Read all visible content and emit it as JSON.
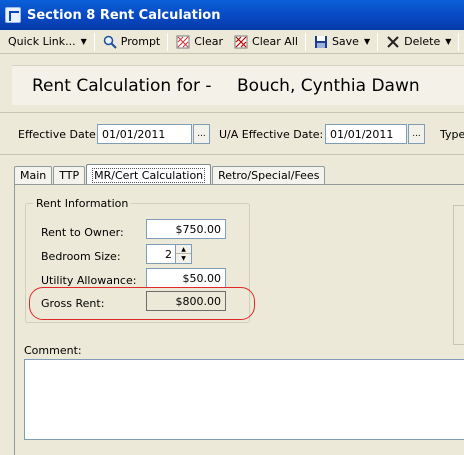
{
  "window": {
    "title": "Section 8 Rent Calculation"
  },
  "toolbar": {
    "quick_link": "Quick Link...",
    "prompt": "Prompt",
    "clear": "Clear",
    "clear_all": "Clear All",
    "save": "Save",
    "delete": "Delete"
  },
  "header": {
    "label": "Rent Calculation for -",
    "name": "Bouch, Cynthia Dawn"
  },
  "dates": {
    "effective_label": "Effective Date:",
    "effective_value": "01/01/2011",
    "ua_label": "U/A Effective Date:",
    "ua_value": "01/01/2011",
    "type_label": "Type:",
    "browse": "..."
  },
  "tabs": [
    "Main",
    "TTP",
    "MR/Cert Calculation",
    "Retro/Special/Fees"
  ],
  "active_tab": "MR/Cert Calculation",
  "rent_info": {
    "title": "Rent Information",
    "rent_to_owner_label": "Rent to Owner:",
    "rent_to_owner": "$750.00",
    "bedroom_label": "Bedroom Size:",
    "bedroom": "2",
    "utility_label": "Utility Allowance:",
    "utility": "$50.00",
    "gross_label": "Gross Rent:",
    "gross": "$800.00"
  },
  "comment": {
    "label": "Comment:",
    "value": ""
  },
  "colors": {
    "title_bar": "#0847c0",
    "highlight": "#e02a2a",
    "face": "#ece9d8"
  }
}
